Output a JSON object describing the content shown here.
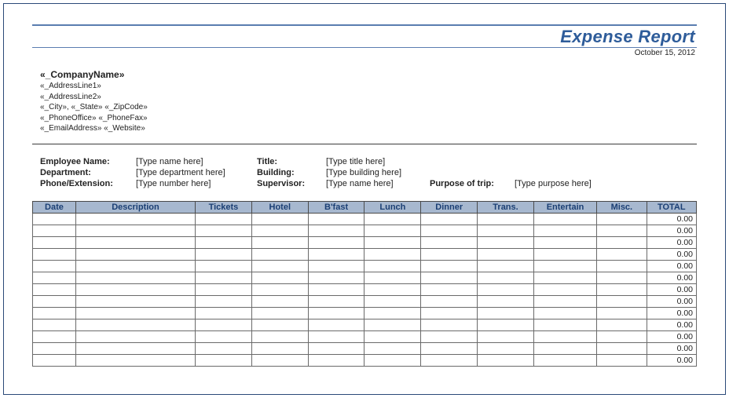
{
  "header": {
    "title": "Expense Report",
    "date": "October 15, 2012"
  },
  "company": {
    "name": "«_CompanyName»",
    "address1": "«_AddressLine1»",
    "address2": "«_AddressLine2»",
    "cityStateZip": "«_City», «_State»  «_ZipCode»",
    "phones": "«_PhoneOffice»  «_PhoneFax»",
    "emailWeb": "«_EmailAddress»  «_Website»"
  },
  "info": {
    "labels": {
      "employee": "Employee Name:",
      "department": "Department:",
      "phone": "Phone/Extension:",
      "title": "Title:",
      "building": "Building:",
      "supervisor": "Supervisor:",
      "purpose": "Purpose of trip:"
    },
    "placeholders": {
      "employee": "[Type name here]",
      "department": "[Type department here]",
      "phone": "[Type number here]",
      "title": "[Type title here]",
      "building": "[Type building here]",
      "supervisor": "[Type name here]",
      "purpose": "[Type purpose here]"
    }
  },
  "table": {
    "headers": {
      "date": "Date",
      "description": "Description",
      "tickets": "Tickets",
      "hotel": "Hotel",
      "bfast": "B'fast",
      "lunch": "Lunch",
      "dinner": "Dinner",
      "trans": "Trans.",
      "entertain": "Entertain",
      "misc": "Misc.",
      "total": "TOTAL"
    },
    "rows": [
      {
        "total": "0.00"
      },
      {
        "total": "0.00"
      },
      {
        "total": "0.00"
      },
      {
        "total": "0.00"
      },
      {
        "total": "0.00"
      },
      {
        "total": "0.00"
      },
      {
        "total": "0.00"
      },
      {
        "total": "0.00"
      },
      {
        "total": "0.00"
      },
      {
        "total": "0.00"
      },
      {
        "total": "0.00"
      },
      {
        "total": "0.00"
      },
      {
        "total": "0.00"
      }
    ]
  }
}
